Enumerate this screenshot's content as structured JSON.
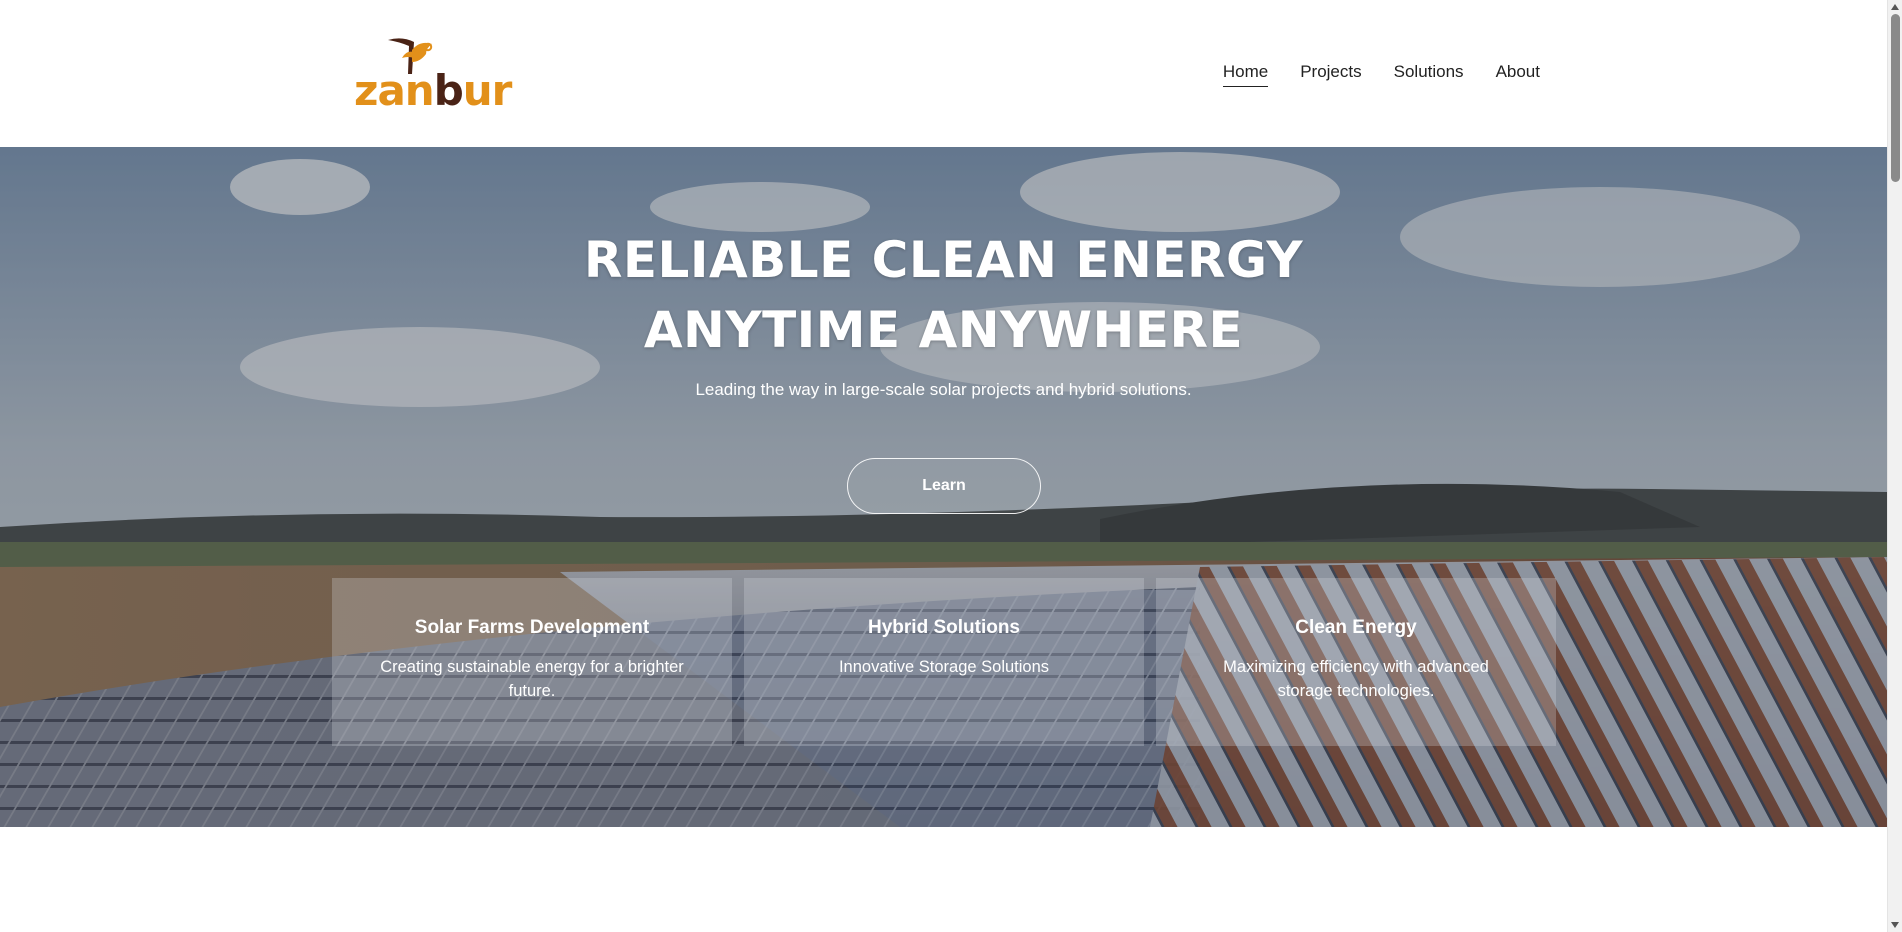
{
  "brand": {
    "logo_text_light": "zan",
    "logo_text_dark": "b",
    "logo_text_end": "ur",
    "logo_icon": "bird-icon",
    "colors": {
      "orange": "#e2901a",
      "brown": "#4a2316"
    }
  },
  "nav": {
    "items": [
      {
        "label": "Home",
        "active": true
      },
      {
        "label": "Projects",
        "active": false
      },
      {
        "label": "Solutions",
        "active": false
      },
      {
        "label": "About",
        "active": false
      }
    ]
  },
  "hero": {
    "title_line1": "RELIABLE CLEAN ENERGY",
    "title_line2": "ANYTIME ANYWHERE",
    "subtitle": "Leading the way in large-scale solar projects and hybrid solutions.",
    "cta_label": "Learn",
    "background": "solar-farm-landscape"
  },
  "cards": [
    {
      "title": "Solar Farms Development",
      "description": "Creating sustainable energy for a brighter future."
    },
    {
      "title": "Hybrid Solutions",
      "description": "Innovative Storage Solutions"
    },
    {
      "title": "Clean Energy",
      "description": "Maximizing efficiency with advanced storage technologies."
    }
  ]
}
